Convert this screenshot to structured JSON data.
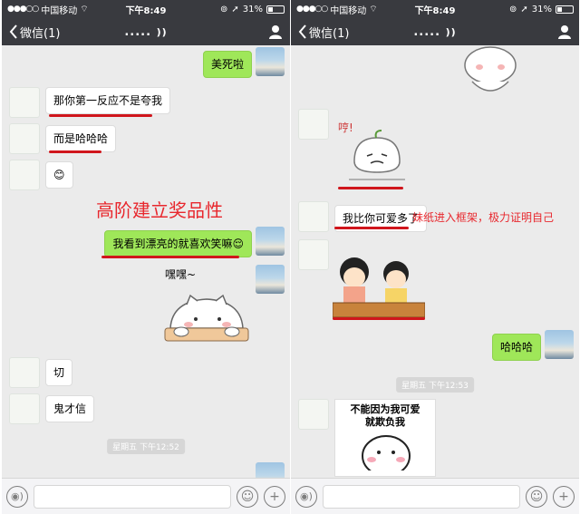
{
  "status_bar": {
    "carrier": "中国移动",
    "time": "下午8:49",
    "battery": "31%"
  },
  "nav": {
    "back_label": "微信(1)",
    "title": "....."
  },
  "left": {
    "messages": [
      {
        "text": "美死啦"
      },
      {
        "text": "那你第一反应不是夸我"
      },
      {
        "text": "而是哈哈哈"
      },
      {
        "text": "😊"
      },
      {
        "text": "我看到漂亮的就喜欢笑嘛😌"
      },
      {
        "text": "切"
      },
      {
        "text": "鬼才信"
      }
    ],
    "annotation": "高阶建立奖品性",
    "sticker_caption": "嘿嘿~",
    "timestamp": "星期五 下午12:52"
  },
  "right": {
    "messages": [
      {
        "text": "我比你可爱多了"
      },
      {
        "text": "哈哈哈"
      }
    ],
    "annotation": "妹纸进入框架，极力证明自己",
    "sticker_caption": "哼!",
    "meme_text": "不能因为我可爱\n就欺负我",
    "timestamp": "星期五 下午12:53"
  },
  "colors": {
    "nav_bg": "#393a3f",
    "chat_bg": "#ebebeb",
    "bubble_out": "#9fe759",
    "annotation": "#e8282e"
  },
  "icons": [
    "back-chevron-icon",
    "user-icon",
    "voice-icon",
    "emoji-icon",
    "plus-icon",
    "earpiece-icon"
  ]
}
